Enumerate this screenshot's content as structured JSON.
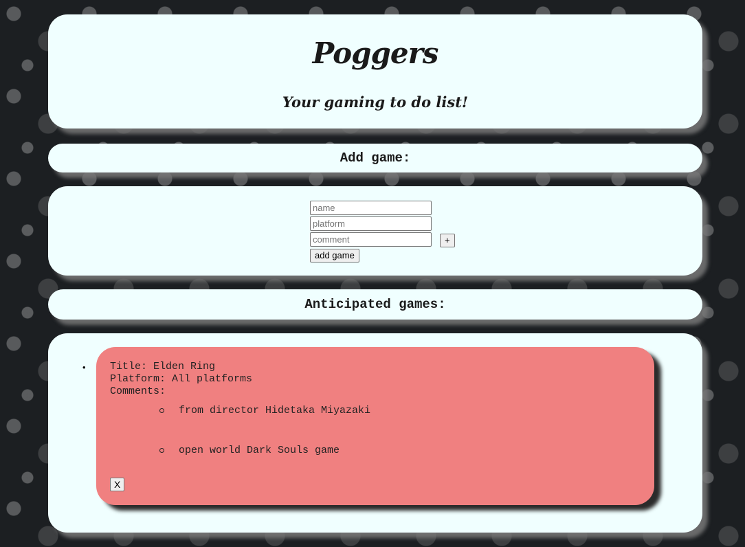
{
  "header": {
    "title": "Poggers",
    "subtitle": "Your gaming to do list!"
  },
  "add_section": {
    "heading": "Add game:",
    "name_placeholder": "name",
    "platform_placeholder": "platform",
    "comment_placeholder": "comment",
    "plus_label": "+",
    "add_label": "add game"
  },
  "list_section": {
    "heading": "Anticipated games:",
    "games": [
      {
        "title_line": "Title: Elden Ring",
        "platform_line": "Platform: All platforms",
        "comments_label": "Comments:",
        "comments": [
          "from director Hidetaka Miyazaki",
          "open world Dark Souls game"
        ],
        "delete_label": "X",
        "card_color": "#f08080"
      }
    ]
  },
  "colors": {
    "panel": "#f0ffff",
    "background": "#1c1f22"
  }
}
